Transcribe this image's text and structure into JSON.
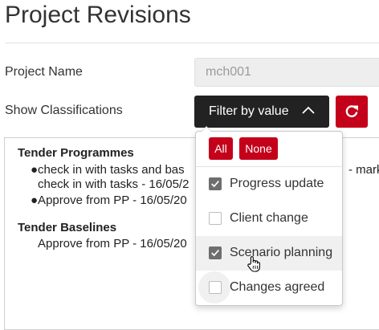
{
  "page": {
    "title": "Project Revisions"
  },
  "form": {
    "project_name_label": "Project Name",
    "project_name_value": "mch001",
    "show_classifications_label": "Show Classifications",
    "filter_button_label": "Filter by value",
    "filter_chevron_icon": "chevron-up-icon",
    "refresh_icon": "refresh-icon"
  },
  "dropdown": {
    "all_label": "All",
    "none_label": "None",
    "options": [
      {
        "label": "Progress update",
        "checked": true
      },
      {
        "label": "Client change",
        "checked": false
      },
      {
        "label": "Scenario planning",
        "checked": true,
        "hovered": true
      },
      {
        "label": "Changes agreed",
        "checked": false
      }
    ]
  },
  "content": {
    "sections": [
      {
        "heading": "Tender Programmes",
        "entries": [
          "●check in with tasks and bas",
          "check in with tasks - 16/05/2",
          "●Approve from PP - 16/05/20"
        ],
        "tail": "- mark"
      },
      {
        "heading": "Tender Baselines",
        "entries": [
          "Approve from PP - 16/05/20"
        ]
      }
    ]
  },
  "colors": {
    "accent_red": "#c4001a",
    "dark_button": "#222222",
    "checkbox_checked": "#6e6e6e"
  }
}
